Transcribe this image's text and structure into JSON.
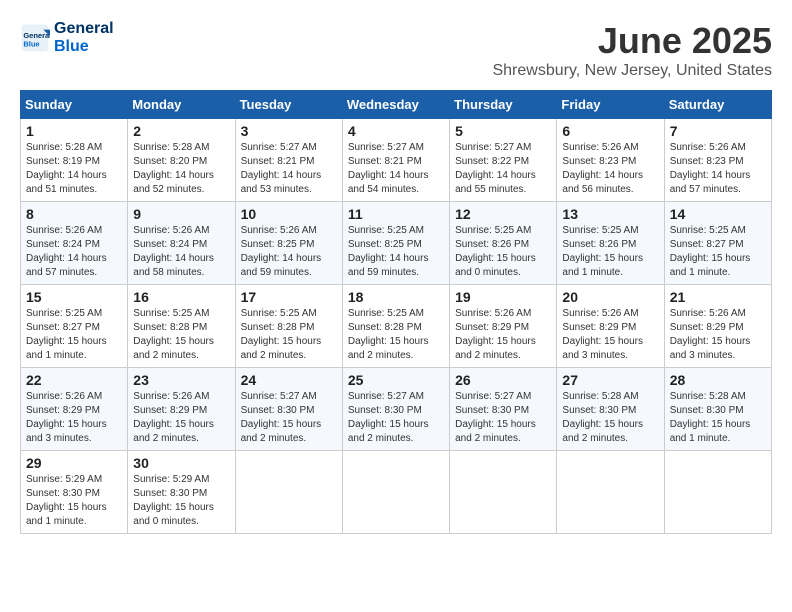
{
  "header": {
    "logo_line1": "General",
    "logo_line2": "Blue",
    "month": "June 2025",
    "location": "Shrewsbury, New Jersey, United States"
  },
  "weekdays": [
    "Sunday",
    "Monday",
    "Tuesday",
    "Wednesday",
    "Thursday",
    "Friday",
    "Saturday"
  ],
  "weeks": [
    [
      {
        "day": "1",
        "info": "Sunrise: 5:28 AM\nSunset: 8:19 PM\nDaylight: 14 hours\nand 51 minutes."
      },
      {
        "day": "2",
        "info": "Sunrise: 5:28 AM\nSunset: 8:20 PM\nDaylight: 14 hours\nand 52 minutes."
      },
      {
        "day": "3",
        "info": "Sunrise: 5:27 AM\nSunset: 8:21 PM\nDaylight: 14 hours\nand 53 minutes."
      },
      {
        "day": "4",
        "info": "Sunrise: 5:27 AM\nSunset: 8:21 PM\nDaylight: 14 hours\nand 54 minutes."
      },
      {
        "day": "5",
        "info": "Sunrise: 5:27 AM\nSunset: 8:22 PM\nDaylight: 14 hours\nand 55 minutes."
      },
      {
        "day": "6",
        "info": "Sunrise: 5:26 AM\nSunset: 8:23 PM\nDaylight: 14 hours\nand 56 minutes."
      },
      {
        "day": "7",
        "info": "Sunrise: 5:26 AM\nSunset: 8:23 PM\nDaylight: 14 hours\nand 57 minutes."
      }
    ],
    [
      {
        "day": "8",
        "info": "Sunrise: 5:26 AM\nSunset: 8:24 PM\nDaylight: 14 hours\nand 57 minutes."
      },
      {
        "day": "9",
        "info": "Sunrise: 5:26 AM\nSunset: 8:24 PM\nDaylight: 14 hours\nand 58 minutes."
      },
      {
        "day": "10",
        "info": "Sunrise: 5:26 AM\nSunset: 8:25 PM\nDaylight: 14 hours\nand 59 minutes."
      },
      {
        "day": "11",
        "info": "Sunrise: 5:25 AM\nSunset: 8:25 PM\nDaylight: 14 hours\nand 59 minutes."
      },
      {
        "day": "12",
        "info": "Sunrise: 5:25 AM\nSunset: 8:26 PM\nDaylight: 15 hours\nand 0 minutes."
      },
      {
        "day": "13",
        "info": "Sunrise: 5:25 AM\nSunset: 8:26 PM\nDaylight: 15 hours\nand 1 minute."
      },
      {
        "day": "14",
        "info": "Sunrise: 5:25 AM\nSunset: 8:27 PM\nDaylight: 15 hours\nand 1 minute."
      }
    ],
    [
      {
        "day": "15",
        "info": "Sunrise: 5:25 AM\nSunset: 8:27 PM\nDaylight: 15 hours\nand 1 minute."
      },
      {
        "day": "16",
        "info": "Sunrise: 5:25 AM\nSunset: 8:28 PM\nDaylight: 15 hours\nand 2 minutes."
      },
      {
        "day": "17",
        "info": "Sunrise: 5:25 AM\nSunset: 8:28 PM\nDaylight: 15 hours\nand 2 minutes."
      },
      {
        "day": "18",
        "info": "Sunrise: 5:25 AM\nSunset: 8:28 PM\nDaylight: 15 hours\nand 2 minutes."
      },
      {
        "day": "19",
        "info": "Sunrise: 5:26 AM\nSunset: 8:29 PM\nDaylight: 15 hours\nand 2 minutes."
      },
      {
        "day": "20",
        "info": "Sunrise: 5:26 AM\nSunset: 8:29 PM\nDaylight: 15 hours\nand 3 minutes."
      },
      {
        "day": "21",
        "info": "Sunrise: 5:26 AM\nSunset: 8:29 PM\nDaylight: 15 hours\nand 3 minutes."
      }
    ],
    [
      {
        "day": "22",
        "info": "Sunrise: 5:26 AM\nSunset: 8:29 PM\nDaylight: 15 hours\nand 3 minutes."
      },
      {
        "day": "23",
        "info": "Sunrise: 5:26 AM\nSunset: 8:29 PM\nDaylight: 15 hours\nand 2 minutes."
      },
      {
        "day": "24",
        "info": "Sunrise: 5:27 AM\nSunset: 8:30 PM\nDaylight: 15 hours\nand 2 minutes."
      },
      {
        "day": "25",
        "info": "Sunrise: 5:27 AM\nSunset: 8:30 PM\nDaylight: 15 hours\nand 2 minutes."
      },
      {
        "day": "26",
        "info": "Sunrise: 5:27 AM\nSunset: 8:30 PM\nDaylight: 15 hours\nand 2 minutes."
      },
      {
        "day": "27",
        "info": "Sunrise: 5:28 AM\nSunset: 8:30 PM\nDaylight: 15 hours\nand 2 minutes."
      },
      {
        "day": "28",
        "info": "Sunrise: 5:28 AM\nSunset: 8:30 PM\nDaylight: 15 hours\nand 1 minute."
      }
    ],
    [
      {
        "day": "29",
        "info": "Sunrise: 5:29 AM\nSunset: 8:30 PM\nDaylight: 15 hours\nand 1 minute."
      },
      {
        "day": "30",
        "info": "Sunrise: 5:29 AM\nSunset: 8:30 PM\nDaylight: 15 hours\nand 0 minutes."
      },
      {
        "day": "",
        "info": ""
      },
      {
        "day": "",
        "info": ""
      },
      {
        "day": "",
        "info": ""
      },
      {
        "day": "",
        "info": ""
      },
      {
        "day": "",
        "info": ""
      }
    ]
  ]
}
